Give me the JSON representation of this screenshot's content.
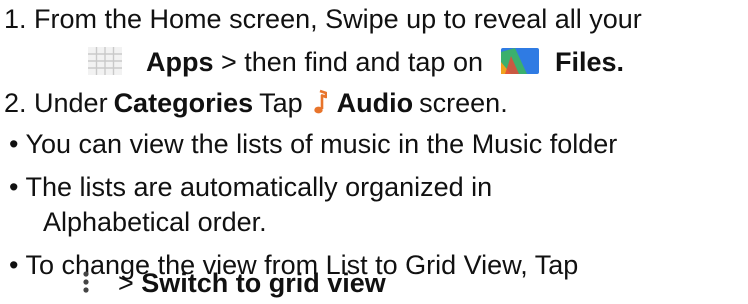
{
  "step1": {
    "line1": "1. From the Home screen, Swipe up to reveal all your",
    "apps_label": "Apps",
    "mid_text": " > then find and tap on",
    "files_label": "Files."
  },
  "step2": {
    "prefix": "2. Under",
    "categories_label": "Categories",
    "tap_text": "Tap",
    "audio_label": "Audio",
    "suffix": "screen."
  },
  "bullets": {
    "b1": "• You can view the lists of music in the Music folder",
    "b2_line1": "• The lists are automatically organized in",
    "b2_line2": "Alphabetical order.",
    "b3_line1": "• To change the view from List to Grid View, Tap",
    "b3_arrow": "> ",
    "b3_action": "Switch to grid view"
  },
  "icons": {
    "apps": "apps-grid-icon",
    "files": "files-app-icon",
    "audio": "music-note-icon",
    "more": "more-options-icon",
    "audio_color": "#e8742b",
    "files_blue": "#2f7be3",
    "files_green": "#3bb06d",
    "files_orange": "#f0a21e"
  }
}
